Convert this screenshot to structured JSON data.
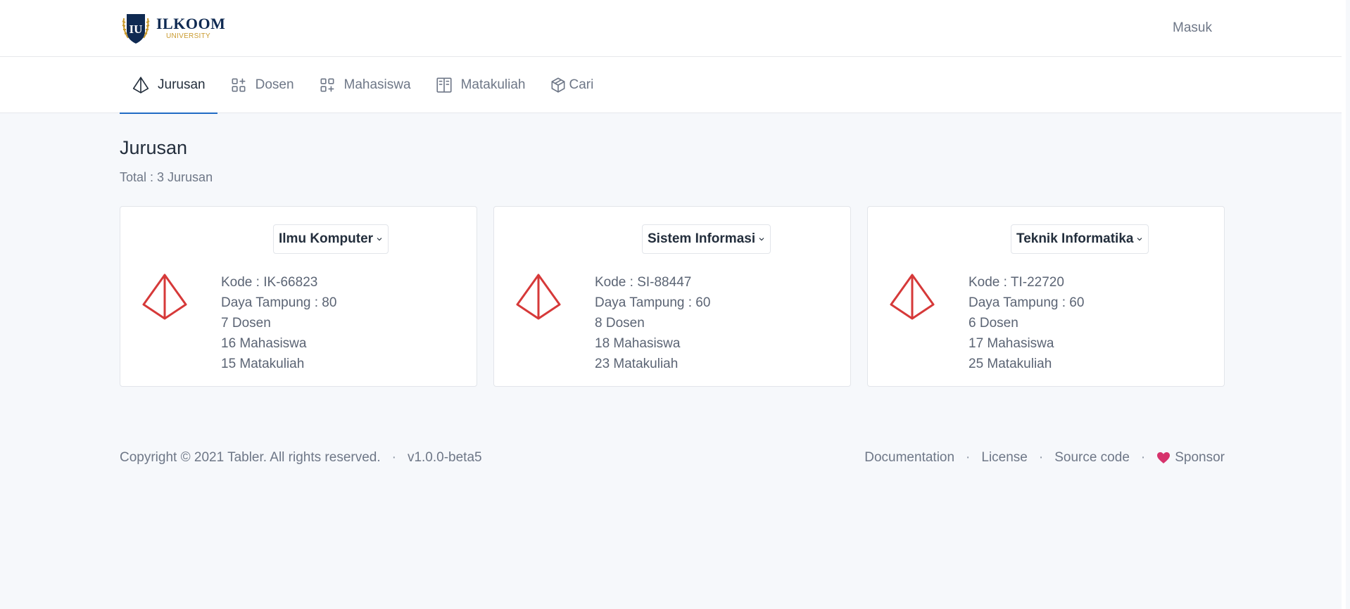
{
  "header": {
    "logo_main": "ILKOOM",
    "logo_sub": "UNIVERSITY",
    "logo_emblem": "IU",
    "signin_label": "Masuk"
  },
  "nav": {
    "items": [
      {
        "label": "Jurusan",
        "icon": "pyramid-icon",
        "active": true
      },
      {
        "label": "Dosen",
        "icon": "apps-icon",
        "active": false
      },
      {
        "label": "Mahasiswa",
        "icon": "apps-icon",
        "active": false
      },
      {
        "label": "Matakuliah",
        "icon": "book-icon",
        "active": false
      },
      {
        "label": "Cari",
        "icon": "box-icon",
        "active": false
      }
    ]
  },
  "main": {
    "title": "Jurusan",
    "subtitle": "Total : 3 Jurusan"
  },
  "cards": [
    {
      "name": "Ilmu Komputer",
      "kode": "Kode : IK-66823",
      "daya": "Daya Tampung : 80",
      "dosen": "7 Dosen",
      "mahasiswa": "16 Mahasiswa",
      "matakuliah": "15 Matakuliah"
    },
    {
      "name": "Sistem Informasi",
      "kode": "Kode : SI-88447",
      "daya": "Daya Tampung : 60",
      "dosen": "8 Dosen",
      "mahasiswa": "18 Mahasiswa",
      "matakuliah": "23 Matakuliah"
    },
    {
      "name": "Teknik Informatika",
      "kode": "Kode : TI-22720",
      "daya": "Daya Tampung : 60",
      "dosen": "6 Dosen",
      "mahasiswa": "17 Mahasiswa",
      "matakuliah": "25 Matakuliah"
    }
  ],
  "footer": {
    "copyright": "Copyright © 2021 Tabler. All rights reserved.",
    "version": "v1.0.0-beta5",
    "links": [
      "Documentation",
      "License",
      "Source code",
      "Sponsor"
    ]
  },
  "colors": {
    "accent": "#206bc4",
    "icon_red": "#d63939",
    "heart": "#d6336c",
    "logo_navy": "#0f2a52",
    "logo_gold": "#c99a2e"
  }
}
